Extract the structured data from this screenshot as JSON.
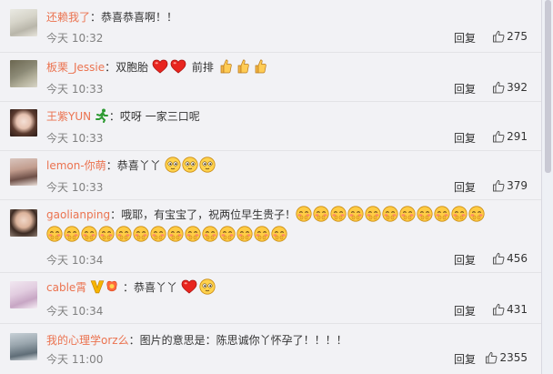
{
  "comments": [
    {
      "user": "还赖我了",
      "text": "：恭喜恭喜啊！！",
      "time": "今天 10:32",
      "reply": "回复",
      "likes": "275"
    },
    {
      "user": "板栗_Jessie",
      "text": "：双胞胎",
      "extra": "前排",
      "time": "今天 10:33",
      "reply": "回复",
      "likes": "392"
    },
    {
      "user": "王紫YUN",
      "text": "：哎呀 一家三口呢",
      "time": "今天 10:33",
      "reply": "回复",
      "likes": "291"
    },
    {
      "user": "lemon-你萌",
      "text": "：恭喜丫丫",
      "time": "今天 10:33",
      "reply": "回复",
      "likes": "379"
    },
    {
      "user": "gaolianping",
      "text": "：哦耶，有宝宝了，祝两位早生贵子！",
      "time": "今天 10:34",
      "reply": "回复",
      "likes": "456"
    },
    {
      "user": "cable霄",
      "text": "：恭喜丫丫",
      "time": "今天 10:34",
      "reply": "回复",
      "likes": "431"
    },
    {
      "user": "我的心理学orz么",
      "text": "：图片的意思是：陈思诚你丫怀孕了！！！！",
      "time": "今天 11:00",
      "reply": "回复",
      "likes": "2355"
    }
  ],
  "colors": {
    "username": "#eb7350",
    "meta": "#808080",
    "background": "#f2f2f5"
  },
  "icons": [
    "thumbs-up-icon",
    "heart-emoji",
    "shy-face-emoji",
    "thumbs-emoji",
    "running-icon",
    "vip-icon"
  ]
}
